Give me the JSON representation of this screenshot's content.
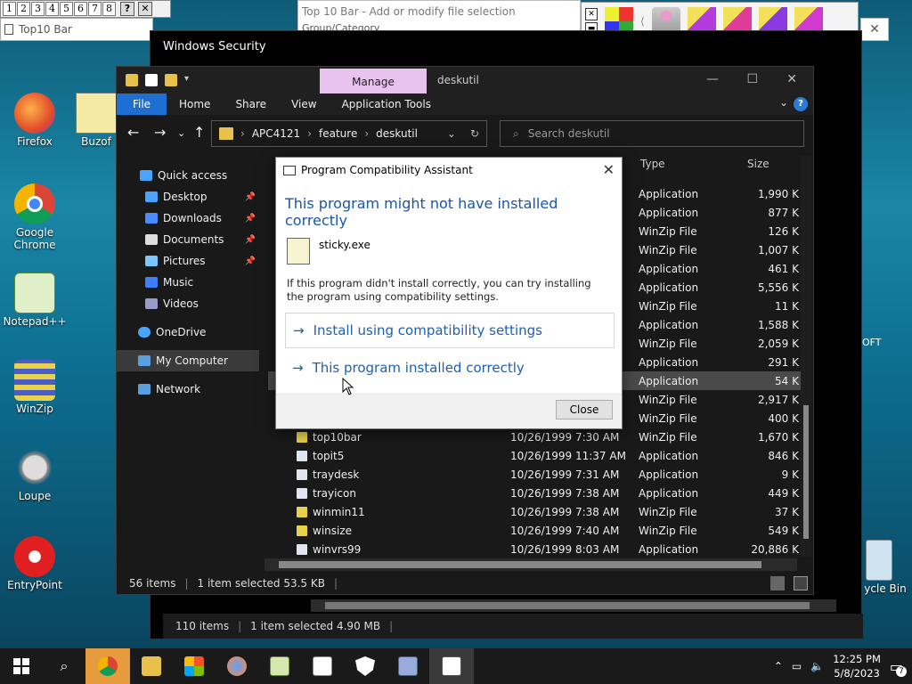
{
  "desktop": {
    "icons": [
      {
        "label": "Firefox"
      },
      {
        "label": "Buzof"
      },
      {
        "label": "Google Chrome"
      },
      {
        "label": "Notepad++"
      },
      {
        "label": "WinZip"
      },
      {
        "label": "Loupe"
      },
      {
        "label": "EntryPoint"
      }
    ],
    "recycle_label": "ycle Bin",
    "partial_text": "OFT"
  },
  "top10bar": {
    "numbers": [
      "1",
      "2",
      "3",
      "4",
      "5",
      "6",
      "7",
      "8"
    ],
    "help": "?",
    "close": "✕",
    "window_title": "Top10 Bar",
    "dialog_title": "Top 10 Bar - Add or modify file selection",
    "dialog_sub": "Group/Category"
  },
  "winsec": {
    "title": "Windows Security",
    "status_items": "110 items",
    "status_selected": "1 item selected  4.90 MB"
  },
  "explorer": {
    "manage_tab": "Manage",
    "title": "deskutil",
    "ribbon_tabs": [
      "File",
      "Home",
      "Share",
      "View",
      "Application Tools"
    ],
    "breadcrumb": [
      "APC4121",
      "feature",
      "deskutil"
    ],
    "search_placeholder": "Search deskutil",
    "nav": [
      {
        "label": "Quick access",
        "color": "#4aa3ff"
      },
      {
        "label": "Desktop",
        "color": "#4aa3ff",
        "pin": true
      },
      {
        "label": "Downloads",
        "color": "#4a8bff",
        "pin": true
      },
      {
        "label": "Documents",
        "color": "#dddddd",
        "pin": true
      },
      {
        "label": "Pictures",
        "color": "#7cc6ff",
        "pin": true
      },
      {
        "label": "Music",
        "color": "#3e7fff"
      },
      {
        "label": "Videos",
        "color": "#9999cc"
      },
      {
        "label": "OneDrive",
        "color": "#4aa3ff"
      },
      {
        "label": "My Computer",
        "color": "#5aa0e0",
        "selected": true
      },
      {
        "label": "Network",
        "color": "#5aa0e0"
      }
    ],
    "columns": {
      "type": "Type",
      "size": "Size"
    },
    "partial_rows": [
      {
        "type": "Application",
        "size": "1,990 K"
      },
      {
        "type": "Application",
        "size": "877 K"
      },
      {
        "type": "WinZip File",
        "size": "126 K"
      },
      {
        "type": "WinZip File",
        "size": "1,007 K"
      },
      {
        "type": "Application",
        "size": "461 K"
      },
      {
        "type": "Application",
        "size": "5,556 K"
      },
      {
        "type": "WinZip File",
        "size": "11 K"
      },
      {
        "type": "Application",
        "size": "1,588 K"
      },
      {
        "type": "WinZip File",
        "size": "2,059 K"
      },
      {
        "type": "Application",
        "size": "291 K"
      },
      {
        "type": "Application",
        "size": "54 K",
        "selected": true
      },
      {
        "type": "WinZip File",
        "size": "2,917 K"
      },
      {
        "type": "WinZip File",
        "size": "400 K"
      }
    ],
    "rows": [
      {
        "name": "top10bar",
        "date": "10/26/1999 7:30 AM",
        "type": "WinZip File",
        "size": "1,670 K"
      },
      {
        "name": "topit5",
        "date": "10/26/1999 11:37 AM",
        "type": "Application",
        "size": "846 K"
      },
      {
        "name": "traydesk",
        "date": "10/26/1999 7:31 AM",
        "type": "Application",
        "size": "9 K"
      },
      {
        "name": "trayicon",
        "date": "10/26/1999 7:38 AM",
        "type": "Application",
        "size": "449 K"
      },
      {
        "name": "winmin11",
        "date": "10/26/1999 7:38 AM",
        "type": "WinZip File",
        "size": "37 K"
      },
      {
        "name": "winsize",
        "date": "10/26/1999 7:40 AM",
        "type": "WinZip File",
        "size": "549 K"
      },
      {
        "name": "winvrs99",
        "date": "10/26/1999 8:03 AM",
        "type": "Application",
        "size": "20,886 K"
      }
    ],
    "status_items": "56 items",
    "status_selected": "1 item selected  53.5 KB"
  },
  "dialog": {
    "title": "Program Compatibility Assistant",
    "heading": "This program might not have installed correctly",
    "program": "sticky.exe",
    "description": "If this program didn't install correctly, you can try installing the program using compatibility settings.",
    "option1": "Install using compatibility settings",
    "option2": "This program installed correctly",
    "close_button": "Close"
  },
  "taskbar": {
    "time": "12:25 PM",
    "date": "5/8/2023",
    "notifications": "7"
  },
  "colors": {
    "accent": "#1e6fd1",
    "manage_tab": "#e8c3f0",
    "link": "#1d60b0",
    "taskbar_active": "#e89b3d"
  }
}
